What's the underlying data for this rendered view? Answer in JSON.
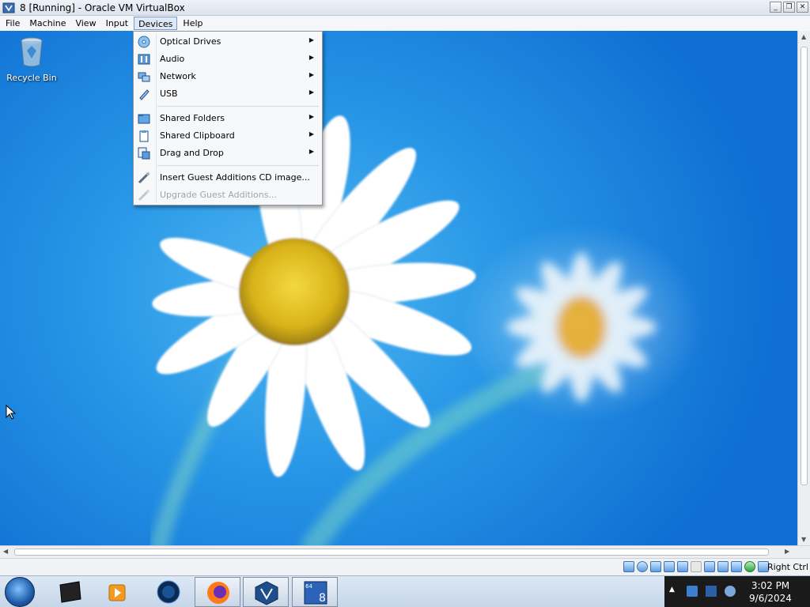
{
  "window": {
    "title": "8 [Running] - Oracle VM VirtualBox",
    "buttons": [
      "minimize",
      "restore",
      "close"
    ]
  },
  "menubar": {
    "items": [
      {
        "label": "File"
      },
      {
        "label": "Machine"
      },
      {
        "label": "View"
      },
      {
        "label": "Input"
      },
      {
        "label": "Devices",
        "active": true
      },
      {
        "label": "Help"
      }
    ]
  },
  "devices_menu": {
    "items": [
      {
        "label": "Optical Drives",
        "icon": "optical-drive-icon",
        "submenu": true,
        "enabled": true
      },
      {
        "label": "Audio",
        "icon": "audio-icon",
        "submenu": true,
        "enabled": true
      },
      {
        "label": "Network",
        "icon": "network-icon",
        "submenu": true,
        "enabled": true
      },
      {
        "label": "USB",
        "icon": "usb-icon",
        "submenu": true,
        "enabled": true
      },
      {
        "label": "Shared Folders",
        "icon": "shared-folders-icon",
        "submenu": true,
        "enabled": true
      },
      {
        "label": "Shared Clipboard",
        "icon": "clipboard-icon",
        "submenu": true,
        "enabled": true
      },
      {
        "label": "Drag and Drop",
        "icon": "drag-drop-icon",
        "submenu": true,
        "enabled": true
      },
      {
        "label": "Insert Guest Additions CD image...",
        "icon": "guest-additions-icon",
        "submenu": false,
        "enabled": true
      },
      {
        "label": "Upgrade Guest Additions...",
        "icon": "upgrade-icon",
        "submenu": false,
        "enabled": false
      }
    ]
  },
  "desktop": {
    "icons": [
      {
        "label": "Recycle Bin",
        "icon": "recycle-bin-icon"
      }
    ]
  },
  "statusbar": {
    "host_key": "Right Ctrl",
    "indicators": [
      "hard-disk-icon",
      "optical-drive-icon",
      "audio-icon",
      "network-icon",
      "usb-icon",
      "shared-folders-icon",
      "display-icon",
      "video-capture-icon",
      "vt-x-icon",
      "mouse-integration-icon",
      "host-key-icon"
    ]
  },
  "taskbar": {
    "apps": [
      "windows-start-icon",
      "terminal-icon",
      "media-player-icon",
      "globe-icon",
      "firefox-icon",
      "virtualbox-icon",
      "windows8-vm-icon"
    ],
    "clock_time": "3:02 PM",
    "clock_date": "9/6/2024"
  },
  "colors": {
    "desktop_blue": "#2796e6",
    "menu_bg": "#f7f8fa",
    "taskbar": "#c6d6e9",
    "disabled_text": "#a0a4aa"
  }
}
